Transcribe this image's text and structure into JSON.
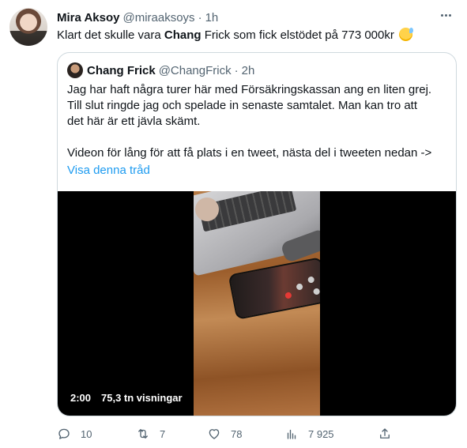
{
  "tweet": {
    "author_name": "Mira Aksoy",
    "author_handle": "@miraaksoys",
    "separator": "·",
    "time": "1h",
    "text_part1": "Klart det skulle vara ",
    "text_bold": "Chang",
    "text_part2": " Frick som fick elstödet på 773 000kr ",
    "emoji_icon": "sweat-smile-emoji"
  },
  "quote": {
    "author_name": "Chang Frick",
    "author_handle": "@ChangFrick",
    "separator": "·",
    "time": "2h",
    "lines": [
      "Jag har haft några turer här med Försäkringskassan ang en liten grej.",
      "Till slut ringde jag och spelade in senaste samtalet. Man kan tro att",
      "det här är ett jävla skämt."
    ],
    "line4": "Videon för lång för att få plats i en tweet, nästa del i tweeten nedan ->",
    "show_thread": "Visa denna tråd",
    "video": {
      "duration": "2:00",
      "views": "75,3 tn visningar"
    }
  },
  "actions": {
    "replies": "10",
    "retweets": "7",
    "likes": "78",
    "views": "7 925"
  },
  "colors": {
    "accent": "#1d9bf0",
    "muted": "#536471",
    "retweet_icon": "#536471",
    "border": "#cfd9de"
  }
}
